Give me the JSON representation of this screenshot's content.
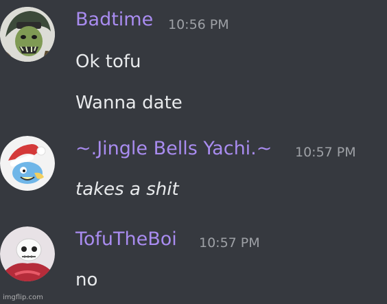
{
  "messages": [
    {
      "username": "Badtime",
      "timestamp": "10:56 PM",
      "lines": [
        "Ok tofu",
        "Wanna date"
      ]
    },
    {
      "username": "~.Jingle Bells Yachi.~",
      "timestamp": "10:57 PM",
      "lines": [
        "takes a shit"
      ]
    },
    {
      "username": "TofuTheBoi",
      "timestamp": "10:57 PM",
      "lines": [
        "no"
      ]
    }
  ],
  "watermark": "imgflip.com",
  "colors": {
    "background": "#36393f",
    "username": "#a98cf0",
    "timestamp": "#9ea1a6",
    "message_text": "#e8eaec"
  },
  "avatars": [
    "zombie-character-avatar",
    "santa-hat-character-avatar",
    "skeleton-character-avatar"
  ]
}
